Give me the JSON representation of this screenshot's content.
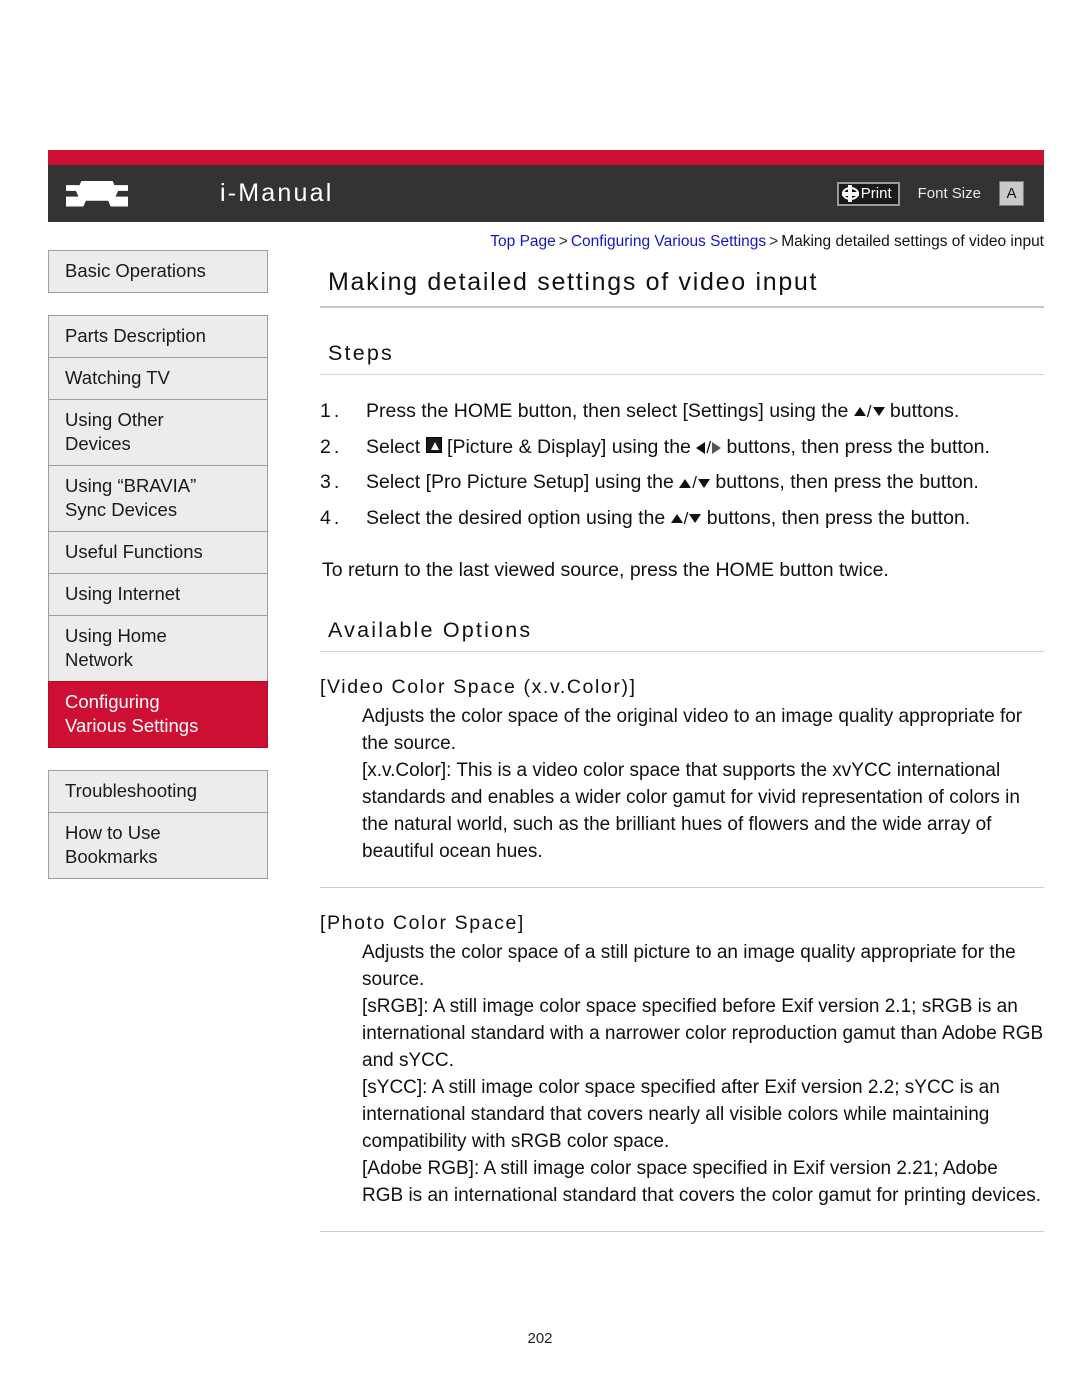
{
  "header": {
    "brand": "i-Manual",
    "logo_icon": "sony-bravia-logo-icon",
    "print_label": "Print",
    "print_icon": "print-target-icon",
    "font_size_label": "Font Size",
    "font_size_value": "A",
    "accent_red": "#cc0f33",
    "bar_dark": "#333333"
  },
  "breadcrumb": {
    "items": [
      {
        "label": "Top Page",
        "link": true
      },
      {
        "label": "Configuring Various Settings",
        "link": true
      },
      {
        "label": "Making detailed settings of video input",
        "link": false
      }
    ],
    "separator": ">"
  },
  "sidebar": {
    "groups": [
      {
        "items": [
          {
            "label": "Basic Operations",
            "active": false
          }
        ]
      },
      {
        "items": [
          {
            "label": "Parts Description",
            "active": false
          },
          {
            "label": "Watching TV",
            "active": false
          },
          {
            "label": "Using Other Devices",
            "line1": "Using Other",
            "line2": "Devices",
            "active": false
          },
          {
            "label": "Using “BRAVIA” Sync Devices",
            "line1": "Using “BRAVIA”",
            "line2": "Sync Devices",
            "active": false
          },
          {
            "label": "Useful Functions",
            "active": false
          },
          {
            "label": "Using Internet",
            "active": false
          },
          {
            "label": "Using Home Network",
            "line1": "Using Home",
            "line2": "Network",
            "active": false
          },
          {
            "label": "Configuring Various Settings",
            "line1": "Configuring",
            "line2": "Various Settings",
            "active": true
          }
        ]
      },
      {
        "items": [
          {
            "label": "Troubleshooting",
            "active": false
          },
          {
            "label": "How to Use Bookmarks",
            "line1": "How to Use",
            "line2": "Bookmarks",
            "active": false
          }
        ]
      }
    ],
    "active_color": "#cc0f33"
  },
  "main": {
    "page_title": "Making detailed settings of video input",
    "steps_heading": "Steps",
    "steps": [
      {
        "number": "1.",
        "parts": [
          {
            "t": "text",
            "v": "Press the HOME button, then select [Settings] using the "
          },
          {
            "t": "updown"
          },
          {
            "t": "text",
            "v": " buttons."
          }
        ]
      },
      {
        "number": "2.",
        "parts": [
          {
            "t": "text",
            "v": "Select "
          },
          {
            "t": "picicon"
          },
          {
            "t": "text",
            "v": " [Picture & Display] using the "
          },
          {
            "t": "leftright"
          },
          {
            "t": "text",
            "v": " buttons, then press the button."
          }
        ]
      },
      {
        "number": "3.",
        "parts": [
          {
            "t": "text",
            "v": "Select [Pro Picture Setup] using the "
          },
          {
            "t": "updown"
          },
          {
            "t": "text",
            "v": " buttons, then press the button."
          }
        ]
      },
      {
        "number": "4.",
        "parts": [
          {
            "t": "text",
            "v": "Select the desired option using the "
          },
          {
            "t": "updown"
          },
          {
            "t": "text",
            "v": " buttons, then press the button."
          }
        ]
      }
    ],
    "return_note": "To return to the last viewed source, press the HOME button twice.",
    "options_heading": "Available Options",
    "options": [
      {
        "name": "[Video Color Space (x.v.Color)]",
        "paragraphs": [
          "Adjusts the color space of the original video to an image quality appropriate for the source.",
          "[x.v.Color]: This is a video color space that supports the xvYCC international standards and enables a wider color gamut for vivid representation of colors in the natural world, such as the brilliant hues of flowers and the wide array of beautiful ocean hues."
        ]
      },
      {
        "name": "[Photo Color Space]",
        "paragraphs": [
          "Adjusts the color space of a still picture to an image quality appropriate for the source.",
          "[sRGB]: A still image color space specified before Exif version 2.1; sRGB is an international standard with a narrower color reproduction gamut than Adobe RGB and sYCC.",
          "[sYCC]: A still image color space specified after Exif version 2.2; sYCC is an international standard that covers nearly all visible colors while maintaining compatibility with sRGB color space.",
          "[Adobe RGB]: A still image color space specified in Exif version 2.21; Adobe RGB is an international standard that covers the color gamut for printing devices."
        ]
      }
    ]
  },
  "footer": {
    "page_number": "202"
  }
}
